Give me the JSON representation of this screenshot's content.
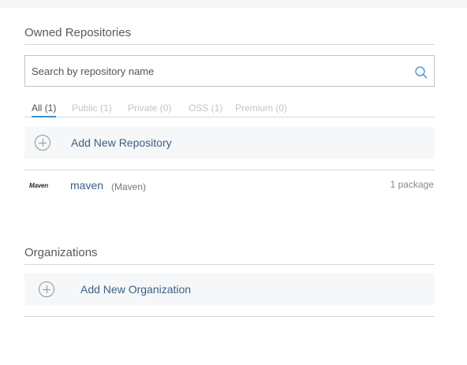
{
  "owned": {
    "title": "Owned Repositories",
    "search_placeholder": "Search by repository name",
    "search_icon": "search-icon",
    "tabs": [
      {
        "label": "All (1)",
        "active": true
      },
      {
        "label": "Public (1)",
        "active": false
      },
      {
        "label": "Private (0)",
        "active": false
      },
      {
        "label": "OSS (1)",
        "active": false
      },
      {
        "label": "Premium (0)",
        "active": false
      }
    ],
    "add_label": "Add New Repository",
    "repos": [
      {
        "logo_text": "Maven",
        "name": "maven",
        "type": "(Maven)",
        "count": "1 package"
      }
    ]
  },
  "organizations": {
    "title": "Organizations",
    "add_label": "Add New Organization"
  },
  "colors": {
    "accent": "#3d8fcf",
    "link": "#3b5f86",
    "row_bg": "#f6f7f8"
  }
}
